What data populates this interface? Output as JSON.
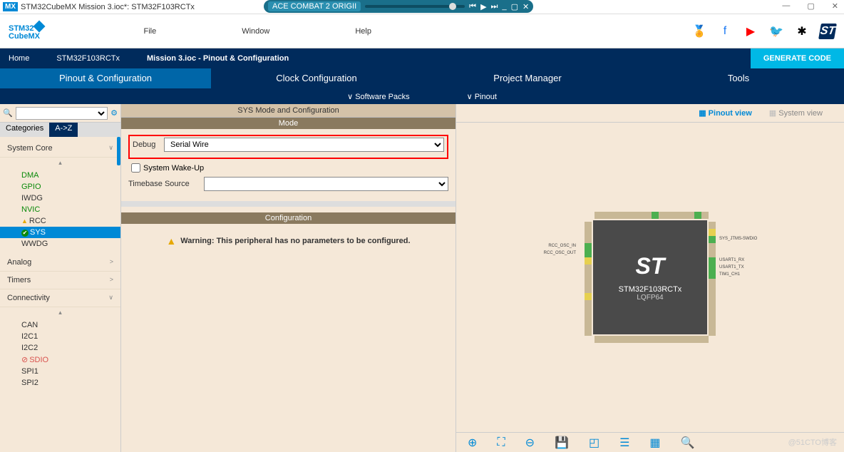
{
  "titlebar": {
    "badge": "MX",
    "text": "STM32CubeMX Mission 3.ioc*: STM32F103RCTx"
  },
  "media": {
    "track": "ACE COMBAT 2 ORIGII"
  },
  "menu": {
    "file": "File",
    "window": "Window",
    "help": "Help"
  },
  "logo": {
    "l1": "STM32",
    "l2": "CubeMX"
  },
  "breadcrumb": {
    "home": "Home",
    "mcu": "STM32F103RCTx",
    "proj": "Mission 3.ioc - Pinout & Configuration"
  },
  "gencode": "GENERATE CODE",
  "tabs": {
    "pinout": "Pinout & Configuration",
    "clock": "Clock Configuration",
    "pm": "Project Manager",
    "tools": "Tools"
  },
  "subtabs": {
    "sw": "Software Packs",
    "pin": "Pinout"
  },
  "cattabs": {
    "cat": "Categories",
    "az": "A->Z"
  },
  "tree": {
    "syscore": "System Core",
    "items1": [
      "DMA",
      "GPIO",
      "IWDG",
      "NVIC",
      "RCC",
      "SYS",
      "WWDG"
    ],
    "analog": "Analog",
    "timers": "Timers",
    "conn": "Connectivity",
    "items2": [
      "CAN",
      "I2C1",
      "I2C2",
      "SDIO",
      "SPI1",
      "SPI2"
    ]
  },
  "mid": {
    "hdr": "SYS Mode and Configuration",
    "mode": "Mode",
    "debug": "Debug",
    "debugval": "Serial Wire",
    "wakeup": "System Wake-Up",
    "tbs": "Timebase Source",
    "cfg": "Configuration",
    "warn": "Warning: This peripheral has no parameters to be configured."
  },
  "views": {
    "pinout": "Pinout view",
    "system": "System view"
  },
  "chip": {
    "part": "STM32F103RCTx",
    "pkg": "LQFP64"
  },
  "labels": {
    "rccin": "RCC_OSC_IN",
    "rccout": "RCC_OSC_OUT",
    "swdio": "SYS_JTMS-SWDIO",
    "u1rx": "USART1_RX",
    "u1tx": "USART1_TX",
    "tim": "TIM1_CH1"
  },
  "watermark": "@51CTO博客"
}
